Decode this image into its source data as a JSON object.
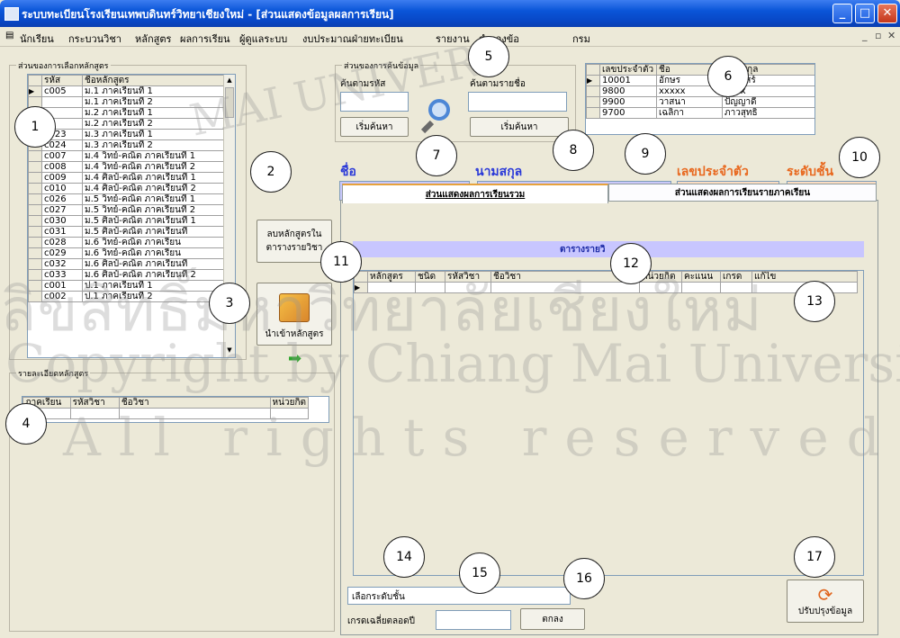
{
  "window": {
    "title": "ระบบทะเบียนโรงเรียนเทพบดินทร์วิทยาเชียงใหม่ - [ส่วนแสดงข้อมูลผลการเรียน]",
    "controls": [
      "_",
      "□",
      "✕"
    ],
    "mdi_controls": [
      "_",
      "▫",
      "✕"
    ]
  },
  "menu": [
    "นักเรียน",
    "กระบวนวิชา",
    "หลักสูตร",
    "ผลการเรียน",
    "ผู้ดูแลระบบ",
    "งบประมาณฝ่ายทะเบียน",
    "รายงาน",
    "สำรองข้อ",
    "กรม"
  ],
  "curriculum_select": {
    "label": "ส่วนของการเลือกหลักสูตร",
    "columns": [
      "รหัส",
      "ชื่อหลักสูตร"
    ],
    "rows": [
      [
        "c005",
        "ม.1 ภาคเรียนที่ 1"
      ],
      [
        "",
        "ม.1 ภาคเรียนที่ 2"
      ],
      [
        "",
        "ม.2 ภาคเรียนที่ 1"
      ],
      [
        "",
        "ม.2 ภาคเรียนที่ 2"
      ],
      [
        "c023",
        "ม.3 ภาคเรียนที่ 1"
      ],
      [
        "c024",
        "ม.3 ภาคเรียนที่ 2"
      ],
      [
        "c007",
        "ม.4 วิทย์-คณิต ภาคเรียนที่ 1"
      ],
      [
        "c008",
        "ม.4 วิทย์-คณิต ภาคเรียนที่ 2"
      ],
      [
        "c009",
        "ม.4 ศิลป์-คณิต ภาคเรียนที่ 1"
      ],
      [
        "c010",
        "ม.4 ศิลป์-คณิต ภาคเรียนที่ 2"
      ],
      [
        "c026",
        "ม.5 วิทย์-คณิต ภาคเรียนที่ 1"
      ],
      [
        "c027",
        "ม.5 วิทย์-คณิต ภาคเรียนที่ 2"
      ],
      [
        "c030",
        "ม.5 ศิลป์-คณิต ภาคเรียนที่ 1"
      ],
      [
        "c031",
        "ม.5 ศิลป์-คณิต ภาคเรียนที่"
      ],
      [
        "c028",
        "ม.6 วิทย์-คณิต ภาคเรียน"
      ],
      [
        "c029",
        "ม.6 วิทย์-คณิต ภาคเรียน"
      ],
      [
        "c032",
        "ม.6 ศิลป์-คณิต ภาคเรียนที่"
      ],
      [
        "c033",
        "ม.6 ศิลป์-คณิต ภาคเรียนที่ 2"
      ],
      [
        "c001",
        "ป.1 ภาคเรียนที่ 1"
      ],
      [
        "c002",
        "ป.1 ภาคเรียนที่ 2"
      ]
    ]
  },
  "buttons": {
    "delete_curriculum": "ลบหลักสูตรใน ตารางรายวิชา",
    "import_curriculum": "นำเข้าหลักสูตร",
    "search_by_code": "เริ่มค้นหา",
    "search_by_name": "เริ่มค้นหา",
    "ok": "ตกลง",
    "refresh": "ปรับปรุงข้อมูล"
  },
  "curriculum_detail": {
    "label": "รายละเอียดหลักสูตร",
    "columns": [
      "ภาคเรียน",
      "รหัสวิชา",
      "ชื่อวิชา",
      "หน่วยกิต"
    ]
  },
  "search": {
    "label": "ส่วนของการค้นข้อมูล",
    "by_code_label": "ค้นตามรหัส",
    "by_name_label": "ค้นตามรายชื่อ"
  },
  "students": {
    "columns": [
      "เลขประจำตัว",
      "ชื่อ",
      "นามสกุล"
    ],
    "rows": [
      [
        "10001",
        "อักษร",
        "กระแสร์"
      ],
      [
        "9800",
        "xxxxx",
        "xxxx"
      ],
      [
        "9900",
        "วาสนา",
        "ปัญญาดี"
      ],
      [
        "9700",
        "เฉลิกา",
        "ภาวสุทธิ"
      ]
    ]
  },
  "info": {
    "name_label": "ชื่อ",
    "surname_label": "นามสกุล",
    "id_label": "เลขประจำตัว",
    "level_label": "ระดับชั้น"
  },
  "tabs": [
    "ส่วนแสดงผลการเรียนรวม",
    "ส่วนแสดงผลการเรียนรายภาคเรียน"
  ],
  "results": {
    "table_title": "ตารางรายวิ",
    "columns": [
      "หลักสูตร",
      "ชนิด",
      "รหัสวิชา",
      "ชื่อวิชา",
      "หน่วยกิต",
      "คะแนน",
      "เกรด",
      "แก้ไข"
    ]
  },
  "bottom": {
    "level_select_label": "เลือกระดับชั้น",
    "gpa_label": "เกรดเฉลี่ยตลอดปี"
  },
  "watermark": [
    "ลิขสิทธิ์มหาวิทยาลัยเชียงใหม่",
    "Copyright by Chiang Mai University",
    "All rights reserved",
    "MAI UNIVERS"
  ],
  "callouts": [
    "1",
    "2",
    "3",
    "4",
    "5",
    "6",
    "7",
    "8",
    "9",
    "10",
    "11",
    "12",
    "13",
    "14",
    "15",
    "16",
    "17"
  ],
  "colors": {
    "title_blue": "#0a55d8",
    "name_field": "#c9c8fa",
    "id_field": "#fadcc2",
    "orange_text": "#e8681e",
    "blue_text": "#2a39d8"
  }
}
